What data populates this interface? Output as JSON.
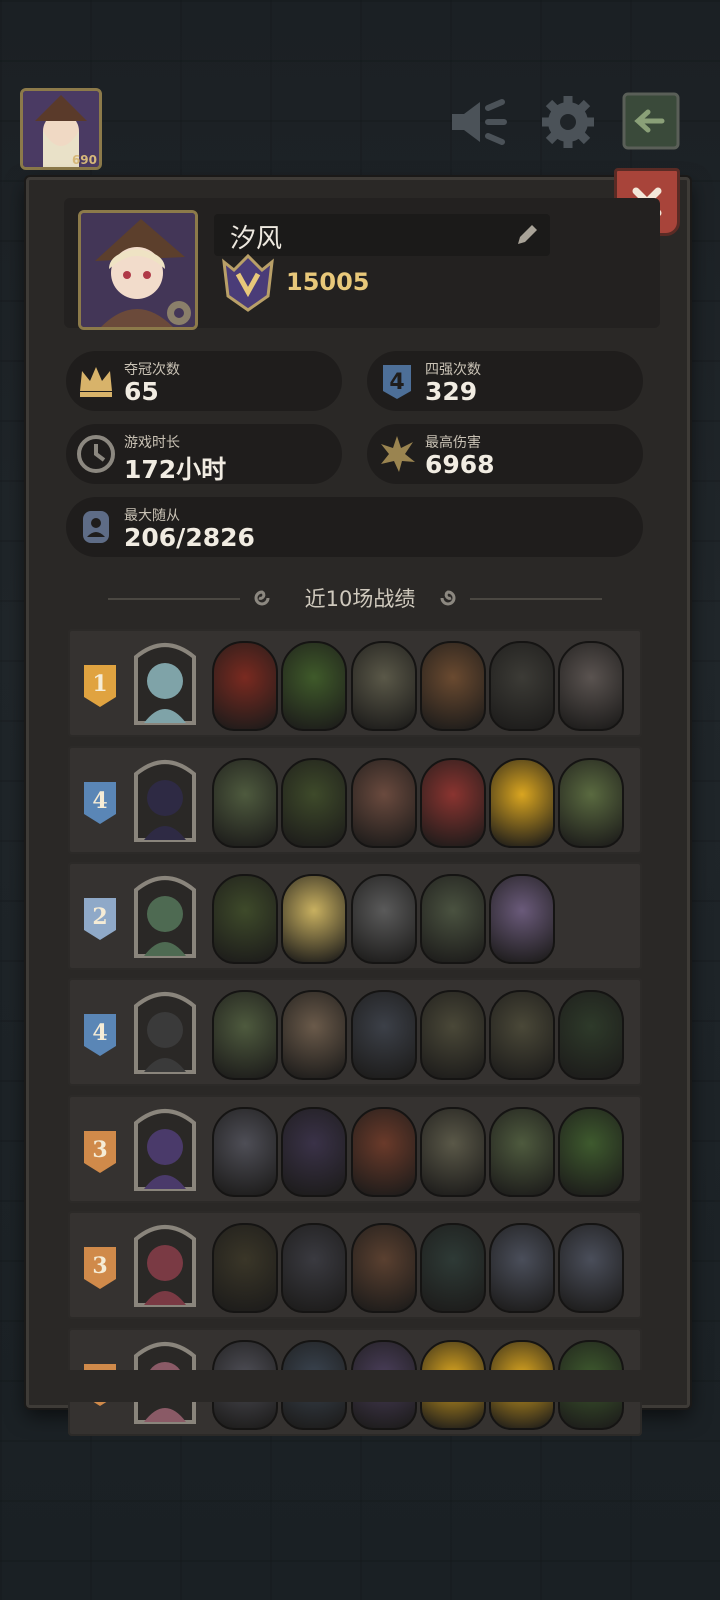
{
  "profile": {
    "name": "汐风",
    "trophies": "15005",
    "avatar_level": "690"
  },
  "stats": [
    {
      "label": "夺冠次数",
      "value": "65",
      "icon": "crown-icon"
    },
    {
      "label": "四强次数",
      "value": "329",
      "icon": "top4-shield-icon"
    },
    {
      "label": "游戏时长",
      "value": "172小时",
      "icon": "clock-icon"
    },
    {
      "label": "最高伤害",
      "value": "6968",
      "icon": "damage-burst-icon"
    },
    {
      "label": "最大随从",
      "value": "206/2826",
      "icon": "minion-card-icon"
    }
  ],
  "recent": {
    "title": "近10场战绩",
    "matches": [
      {
        "rank": "1",
        "rank_color": "#e0a340",
        "hero_color": "#7fa3a8",
        "units": [
          "#7a2a20",
          "#3f5a2a",
          "#5a5848",
          "#6a4a30",
          "#3c3b36",
          "#5a5350"
        ]
      },
      {
        "rank": "4",
        "rank_color": "#5a86b6",
        "hero_color": "#2e2a44",
        "units": [
          "#4e5a3e",
          "#3e4a2a",
          "#6a4a3e",
          "#8a3430",
          "#d9a520",
          "#5a6a40"
        ]
      },
      {
        "rank": "2",
        "rank_color": "#8fa9c8",
        "hero_color": "#4e6a52",
        "units": [
          "#3e4a2a",
          "#c8b060",
          "#5a5a5a",
          "#4a5240",
          "#6a5a7a"
        ]
      },
      {
        "rank": "4",
        "rank_color": "#5a86b6",
        "hero_color": "#3a3a3a",
        "units": [
          "#4e5a3e",
          "#6a5a4a",
          "#3c4048",
          "#4a4838",
          "#4a4838",
          "#2e3a2a"
        ]
      },
      {
        "rank": "3",
        "rank_color": "#d08a4a",
        "hero_color": "#4a3a6a",
        "units": [
          "#4e4e56",
          "#3a3248",
          "#6a3a2a",
          "#5a5848",
          "#4e5a3e",
          "#3e5a2e"
        ]
      },
      {
        "rank": "3",
        "rank_color": "#d08a4a",
        "hero_color": "#7a3a44",
        "units": [
          "#3a3628",
          "#3a3a40",
          "#5a4030",
          "#2e3a36",
          "#4a4e5a",
          "#4a4e5a"
        ]
      },
      {
        "rank": "",
        "rank_color": "#d08a4a",
        "hero_color": "#8a5a66",
        "units": [
          "#4e4e56",
          "#3a4450",
          "#4a3e5a",
          "#d9a520",
          "#d9a520",
          "#3e5a2e"
        ]
      }
    ]
  },
  "colors": {
    "accent": "#e8c87a",
    "close": "#a8443a"
  }
}
